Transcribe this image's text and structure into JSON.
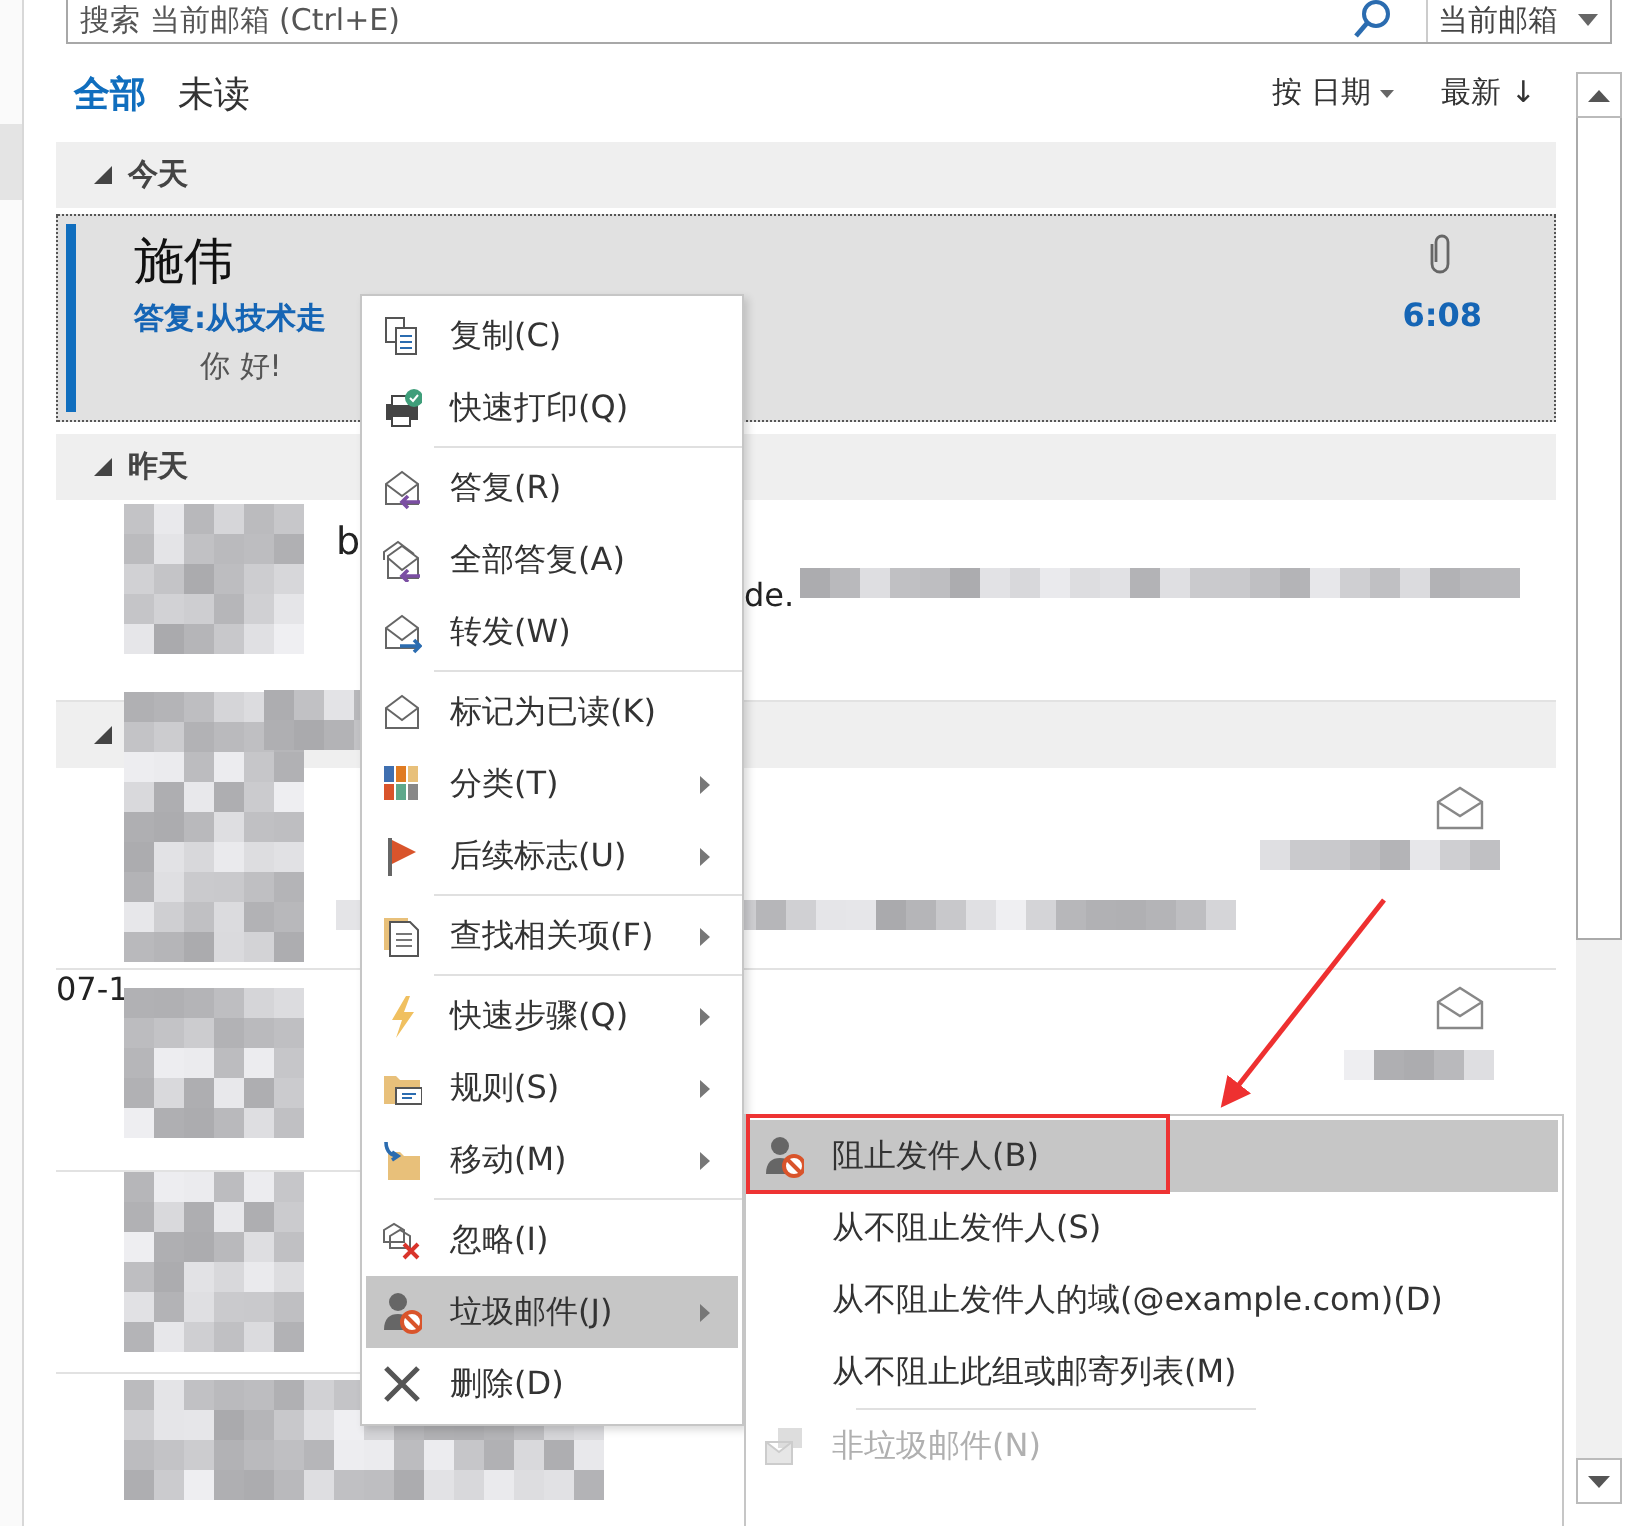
{
  "search": {
    "placeholder": "搜索 当前邮箱 (Ctrl+E)",
    "scope": "当前邮箱"
  },
  "filters": [
    {
      "label": "全部",
      "selected": true
    },
    {
      "label": "未读",
      "selected": false
    }
  ],
  "sort": {
    "by": "按 日期",
    "order": "最新 ↓"
  },
  "groups": [
    {
      "title": "今天",
      "messages": [
        {
          "sender": "施伟",
          "subject": "答复:从技术走",
          "preview": "你 好!",
          "time": "6:08",
          "attachment": true,
          "selected": true
        }
      ]
    },
    {
      "title": "昨天",
      "messages": [
        {
          "fragments": [
            "b",
            "de."
          ],
          "selected": false
        }
      ]
    },
    {
      "messages": [
        {
          "selected": false
        },
        {
          "fragments": [
            "07-1"
          ],
          "selected": false
        },
        {
          "selected": false
        }
      ]
    }
  ],
  "context_menu": {
    "items": [
      {
        "label": "复制(C)",
        "submenu": false,
        "selected": false,
        "separator_after": false
      },
      {
        "label": "快速打印(Q)",
        "submenu": false,
        "selected": false,
        "separator_after": true
      },
      {
        "label": "答复(R)",
        "submenu": false,
        "selected": false,
        "separator_after": false
      },
      {
        "label": "全部答复(A)",
        "submenu": false,
        "selected": false,
        "separator_after": false
      },
      {
        "label": "转发(W)",
        "submenu": false,
        "selected": false,
        "separator_after": true
      },
      {
        "label": "标记为已读(K)",
        "submenu": false,
        "selected": false,
        "separator_after": false
      },
      {
        "label": "分类(T)",
        "submenu": true,
        "selected": false,
        "separator_after": false
      },
      {
        "label": "后续标志(U)",
        "submenu": true,
        "selected": false,
        "separator_after": true
      },
      {
        "label": "查找相关项(F)",
        "submenu": true,
        "selected": false,
        "separator_after": true
      },
      {
        "label": "快速步骤(Q)",
        "submenu": true,
        "selected": false,
        "separator_after": false
      },
      {
        "label": "规则(S)",
        "submenu": true,
        "selected": false,
        "separator_after": false
      },
      {
        "label": "移动(M)",
        "submenu": true,
        "selected": false,
        "separator_after": true
      },
      {
        "label": "忽略(I)",
        "submenu": false,
        "selected": false,
        "separator_after": false
      },
      {
        "label": "垃圾邮件(J)",
        "submenu": true,
        "selected": true,
        "separator_after": false
      },
      {
        "label": "删除(D)",
        "submenu": false,
        "selected": false,
        "separator_after": false
      }
    ]
  },
  "junk_submenu": {
    "items": [
      {
        "label": "阻止发件人(B)",
        "selected": true,
        "disabled": false,
        "separator_after": false
      },
      {
        "label": "从不阻止发件人(S)",
        "selected": false,
        "disabled": false,
        "separator_after": false
      },
      {
        "label": "从不阻止发件人的域(@example.com)(D)",
        "selected": false,
        "disabled": false,
        "separator_after": false
      },
      {
        "label": "从不阻止此组或邮寄列表(M)",
        "selected": false,
        "disabled": false,
        "separator_after": true
      },
      {
        "label": "非垃圾邮件(N)",
        "selected": false,
        "disabled": true,
        "separator_after": false
      }
    ]
  }
}
